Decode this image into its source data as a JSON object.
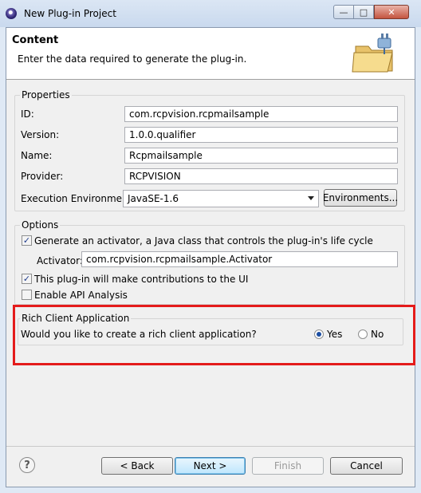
{
  "window": {
    "title": "New Plug-in Project",
    "controls": {
      "minimize": "—",
      "maximize": "□",
      "close": "✕"
    }
  },
  "header": {
    "title": "Content",
    "description": "Enter the data required to generate the plug-in."
  },
  "properties": {
    "group_title": "Properties",
    "id_label": "ID:",
    "id_value": "com.rcpvision.rcpmailsample",
    "version_label": "Version:",
    "version_value": "1.0.0.qualifier",
    "name_label": "Name:",
    "name_value": "Rcpmailsample",
    "provider_label": "Provider:",
    "provider_value": "RCPVISION",
    "env_label": "Execution Environment:",
    "env_value": "JavaSE-1.6",
    "env_button": "Environments..."
  },
  "options": {
    "group_title": "Options",
    "activator_check_label": "Generate an activator, a Java class that controls the plug-in's life cycle",
    "activator_checked": true,
    "activator_label": "Activator:",
    "activator_value": "com.rcpvision.rcpmailsample.Activator",
    "ui_check_label": "This plug-in will make contributions to the UI",
    "ui_checked": true,
    "api_check_label": "Enable API Analysis",
    "api_checked": false
  },
  "rich_client": {
    "group_title": "Rich Client Application",
    "question": "Would you like to create a rich client application?",
    "yes_label": "Yes",
    "no_label": "No",
    "selected": "Yes"
  },
  "footer": {
    "help_glyph": "?",
    "back_label": "< Back",
    "next_label": "Next >",
    "finish_label": "Finish",
    "cancel_label": "Cancel"
  },
  "icons": {
    "app": "eclipse-icon",
    "banner": "folder-plug-icon",
    "dropdown": "chevron-down-icon",
    "help": "help-icon"
  },
  "colors": {
    "highlight": "#e41b1b",
    "radio_selected": "#1c4fa3"
  }
}
